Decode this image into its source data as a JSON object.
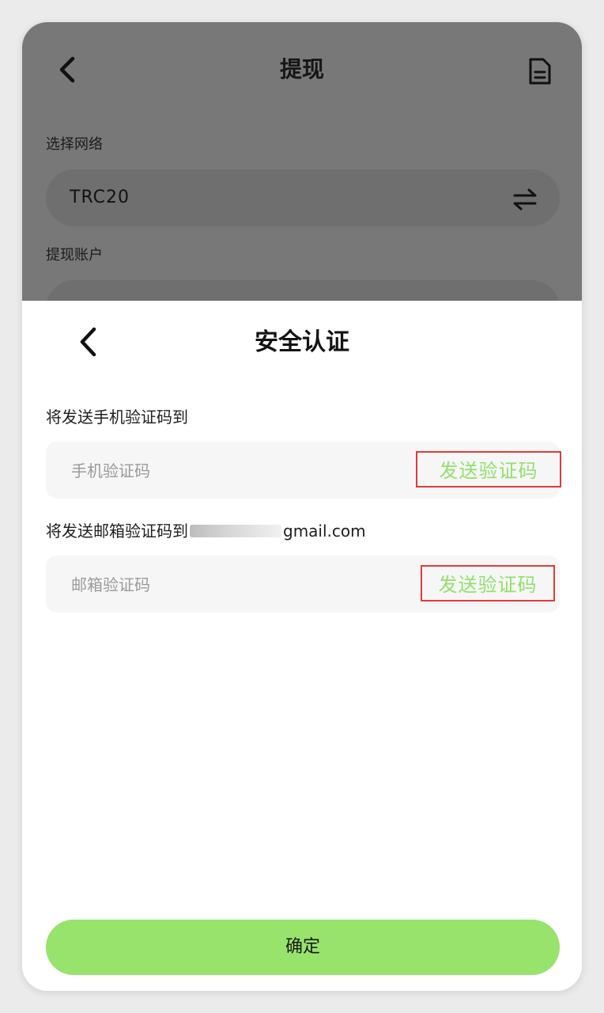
{
  "background_page": {
    "title": "提现",
    "network_label": "选择网络",
    "network_value": "TRC20",
    "account_label": "提现账户",
    "icons": {
      "back": "back-chevron-icon",
      "doc": "document-icon",
      "swap": "swap-arrows-icon"
    }
  },
  "sheet": {
    "title": "安全认证",
    "phone": {
      "label": "将发送手机验证码到",
      "placeholder": "手机验证码",
      "send_label": "发送验证码"
    },
    "email": {
      "label_prefix": "将发送邮箱验证码到",
      "label_suffix": "gmail.com",
      "placeholder": "邮箱验证码",
      "send_label": "发送验证码"
    },
    "confirm_label": "确定"
  },
  "colors": {
    "accent_green": "#98e36c",
    "send_text_green": "#93e06c",
    "highlight_red": "#e23a3a",
    "overlay_gray": "#787878"
  }
}
